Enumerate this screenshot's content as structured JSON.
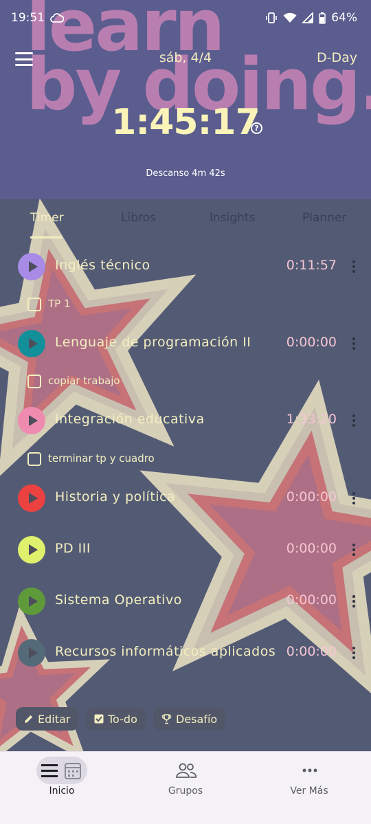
{
  "status_bar": {
    "time": "19:51",
    "battery": "64%",
    "icons": [
      "cloud-icon",
      "vibrate-icon",
      "wifi-icon",
      "signal-icon",
      "battery-icon"
    ]
  },
  "header": {
    "background_slogan": "learn\nby doing.",
    "date": "sáb, 4/4",
    "dday_label": "D-Day",
    "clock": "1:45:17",
    "rest_text": "Descanso 4m 42s"
  },
  "tabs": [
    {
      "label": "Timer",
      "active": true
    },
    {
      "label": "Libros",
      "active": false
    },
    {
      "label": "Insights",
      "active": false
    },
    {
      "label": "Planner",
      "active": false
    }
  ],
  "subjects": [
    {
      "name": "Inglés técnico",
      "time": "0:11:57",
      "color": "#a78be6",
      "todo": "TP 1"
    },
    {
      "name": "Lenguaje de programación II",
      "time": "0:00:00",
      "color": "#138f9a",
      "todo": "copiar trabajo"
    },
    {
      "name": "Integración educativa",
      "time": "1:33:20",
      "color": "#f08bb0",
      "todo": "terminar tp y cuadro"
    },
    {
      "name": "Historia y política",
      "time": "0:00:00",
      "color": "#ec4141",
      "todo": ""
    },
    {
      "name": "PD III",
      "time": "0:00:00",
      "color": "#dff06c",
      "todo": ""
    },
    {
      "name": "Sistema Operativo",
      "time": "0:00:00",
      "color": "#5f9a3a",
      "todo": ""
    },
    {
      "name": "Recursos informáticos aplicados",
      "time": "0:00:00",
      "color": "#546a78",
      "todo": ""
    }
  ],
  "actions": {
    "edit": "Editar",
    "todo": "To-do",
    "challenge": "Desafío"
  },
  "bottom_nav": [
    {
      "label": "Inicio",
      "icon": "list-calendar-icon",
      "active": true
    },
    {
      "label": "Grupos",
      "icon": "group-icon",
      "active": false
    },
    {
      "label": "Ver Más",
      "icon": "more-icon",
      "active": false
    }
  ]
}
